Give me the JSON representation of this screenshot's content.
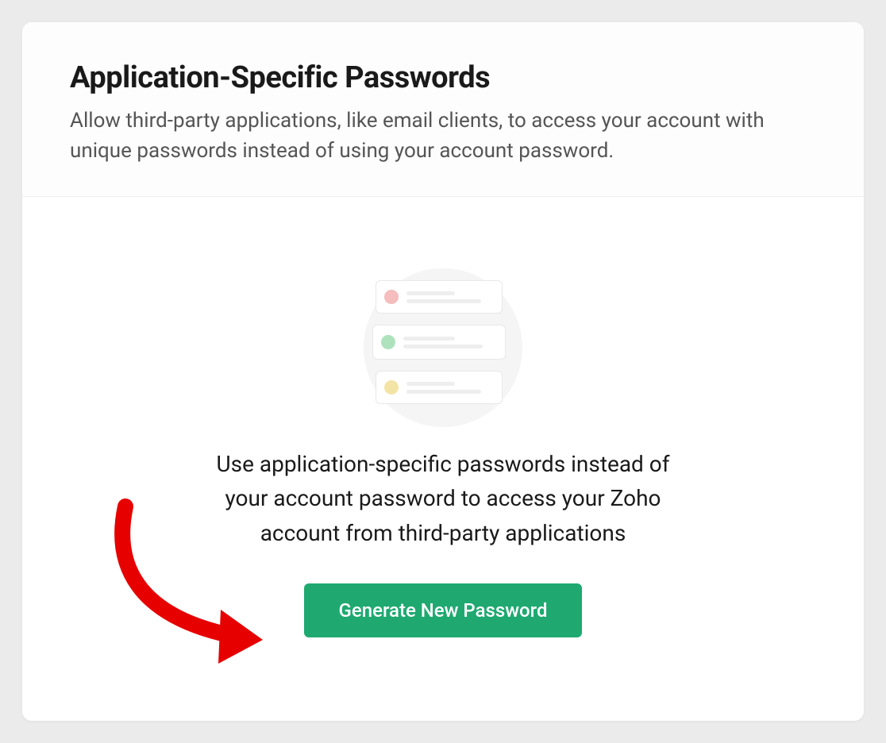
{
  "header": {
    "title": "Application-Specific Passwords",
    "description": "Allow third-party applications, like email clients, to access your account with unique passwords instead of using your account password."
  },
  "body": {
    "message": "Use application-specific passwords instead of your account password to access your Zoho account from third-party applications",
    "button_label": "Generate New Password"
  },
  "colors": {
    "primary_button": "#1fa971",
    "annotation_arrow": "#e60000"
  }
}
